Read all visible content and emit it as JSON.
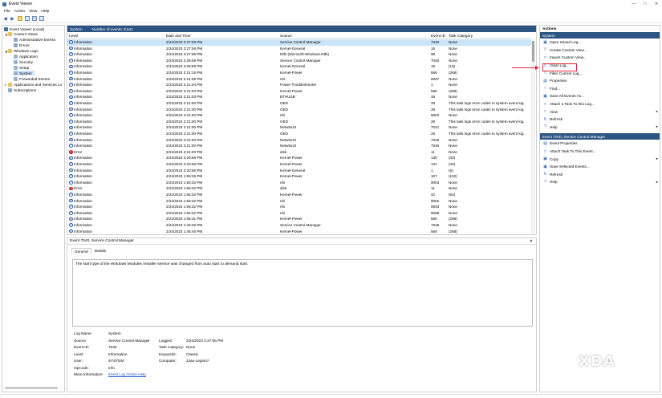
{
  "window": {
    "title": "Event Viewer"
  },
  "menu": [
    "File",
    "Action",
    "View",
    "Help"
  ],
  "tree": {
    "root": "Event Viewer (Local)",
    "custom_views": "Custom Views",
    "admin_events": "Administrative Events",
    "errors": "Errors",
    "windows_logs": "Windows Logs",
    "application": "Application",
    "security": "Security",
    "setup": "Setup",
    "system": "System",
    "forwarded": "Forwarded Events",
    "apps_services": "Applications and Services Lo",
    "subscriptions": "Subscriptions"
  },
  "events_panel": {
    "title": "System",
    "count": "Number of events: 8,641",
    "columns": {
      "level": "Level",
      "date": "Date and Time",
      "source": "Source",
      "id": "Event ID",
      "task": "Task Category"
    }
  },
  "events": [
    {
      "level": "Information",
      "date": "2/24/2023 2:27:06 PM",
      "source": "Service Control Manager",
      "id": "7040",
      "task": "None",
      "err": false
    },
    {
      "level": "Information",
      "date": "2/24/2023 2:27:06 PM",
      "source": "Kernel-General",
      "id": "16",
      "task": "None",
      "err": false
    },
    {
      "level": "Information",
      "date": "2/24/2023 2:27:06 PM",
      "source": "Ntfs (Microsoft-Windows-Ntfs)",
      "id": "98",
      "task": "None",
      "err": false
    },
    {
      "level": "Information",
      "date": "2/24/2023 2:26:59 PM",
      "source": "Service Control Manager",
      "id": "7040",
      "task": "None",
      "err": false
    },
    {
      "level": "Information",
      "date": "2/24/2023 2:26:58 PM",
      "source": "Kernel-General",
      "id": "15",
      "task": "(10)",
      "err": false
    },
    {
      "level": "Information",
      "date": "2/24/2023 2:21:15 PM",
      "source": "Kernel-Power",
      "id": "566",
      "task": "(268)",
      "err": false
    },
    {
      "level": "Information",
      "date": "2/24/2023 2:21:08 PM",
      "source": "nhi",
      "id": "9007",
      "task": "None",
      "err": false
    },
    {
      "level": "Information",
      "date": "2/24/2023 2:21:04 PM",
      "source": "Power-Troubleshooter",
      "id": "1",
      "task": "None",
      "err": false
    },
    {
      "level": "Information",
      "date": "2/24/2023 2:21:03 PM",
      "source": "Kernel-Power",
      "id": "566",
      "task": "(268)",
      "err": false
    },
    {
      "level": "Information",
      "date": "2/24/2023 2:21:03 PM",
      "source": "BTHUSB",
      "id": "18",
      "task": "None",
      "err": false
    },
    {
      "level": "Information",
      "date": "2/24/2023 2:21:00 PM",
      "source": "OED",
      "id": "28",
      "task": "This task logs error codes to system event log.",
      "err": false
    },
    {
      "level": "Information",
      "date": "2/24/2023 2:21:00 PM",
      "source": "OED",
      "id": "28",
      "task": "This task logs error codes to system event log.",
      "err": false
    },
    {
      "level": "Information",
      "date": "2/24/2023 2:21:00 PM",
      "source": "nhi",
      "id": "9002",
      "task": "None",
      "err": false
    },
    {
      "level": "Information",
      "date": "2/24/2023 2:21:00 PM",
      "source": "OED",
      "id": "28",
      "task": "This task logs error codes to system event log.",
      "err": false
    },
    {
      "level": "Information",
      "date": "2/24/2023 2:21:00 PM",
      "source": "Netwtw10",
      "id": "7021",
      "task": "None",
      "err": false
    },
    {
      "level": "Information",
      "date": "2/24/2023 2:21:00 PM",
      "source": "OED",
      "id": "28",
      "task": "This task logs error codes to system event log.",
      "err": false
    },
    {
      "level": "Information",
      "date": "2/24/2023 2:21:00 PM",
      "source": "Netwtw10",
      "id": "7025",
      "task": "None",
      "err": false
    },
    {
      "level": "Information",
      "date": "2/24/2023 2:21:00 PM",
      "source": "Netwtw10",
      "id": "7026",
      "task": "None",
      "err": false
    },
    {
      "level": "Error",
      "date": "2/24/2023 2:21:00 PM",
      "source": "disk",
      "id": "11",
      "task": "None",
      "err": true
    },
    {
      "level": "Information",
      "date": "2/24/2023 2:20:58 PM",
      "source": "Kernel-Power",
      "id": "130",
      "task": "(33)",
      "err": false
    },
    {
      "level": "Information",
      "date": "2/24/2023 2:20:58 PM",
      "source": "Kernel-Power",
      "id": "131",
      "task": "(33)",
      "err": false
    },
    {
      "level": "Information",
      "date": "2/24/2023 2:20:58 PM",
      "source": "Kernel-General",
      "id": "1",
      "task": "(5)",
      "err": false
    },
    {
      "level": "Information",
      "date": "2/24/2023 1:56:35 PM",
      "source": "Kernel-Power",
      "id": "107",
      "task": "(102)",
      "err": false
    },
    {
      "level": "Information",
      "date": "2/24/2023 1:56:32 PM",
      "source": "nhi",
      "id": "9003",
      "task": "None",
      "err": false
    },
    {
      "level": "Error",
      "date": "2/24/2023 1:56:32 PM",
      "source": "disk",
      "id": "11",
      "task": "None",
      "err": true
    },
    {
      "level": "Information",
      "date": "2/24/2023 1:56:32 PM",
      "source": "Kernel-Power",
      "id": "42",
      "task": "(64)",
      "err": false
    },
    {
      "level": "Information",
      "date": "2/24/2023 1:56:32 PM",
      "source": "nhi",
      "id": "9002",
      "task": "None",
      "err": false
    },
    {
      "level": "Information",
      "date": "2/24/2023 1:56:32 PM",
      "source": "nhi",
      "id": "9003",
      "task": "None",
      "err": false
    },
    {
      "level": "Information",
      "date": "2/24/2023 1:56:32 PM",
      "source": "nhi",
      "id": "9008",
      "task": "None",
      "err": false
    },
    {
      "level": "Information",
      "date": "2/24/2023 1:56:31 PM",
      "source": "Kernel-Power",
      "id": "566",
      "task": "(268)",
      "err": false
    },
    {
      "level": "Information",
      "date": "2/24/2023 1:46:46 PM",
      "source": "Service Control Manager",
      "id": "7045",
      "task": "None",
      "err": false
    },
    {
      "level": "Information",
      "date": "2/24/2023 1:46:46 PM",
      "source": "Kernel-Power",
      "id": "566",
      "task": "(268)",
      "err": false
    }
  ],
  "detail": {
    "title": "Event 7040, Service Control Manager",
    "tab_general": "General",
    "tab_details": "Details",
    "message": "The start type of the Windows Modules Installer service was changed from auto start to demand start.",
    "labels": {
      "log_name": "Log Name:",
      "source": "Source:",
      "event_id": "Event ID:",
      "level": "Level:",
      "user": "User:",
      "opcode": "OpCode:",
      "more_info": "More Information:",
      "logged": "Logged:",
      "task_category": "Task Category:",
      "keywords": "Keywords:",
      "computer": "Computer:"
    },
    "values": {
      "log_name": "System",
      "source": "Service Control Manager",
      "event_id": "7040",
      "level": "Information",
      "user": "SYSTEM",
      "opcode": "Info",
      "more_info": "Event Log Online Help",
      "logged": "2/24/2023 2:27:06 PM",
      "task_category": "None",
      "keywords": "Classic",
      "computer": "Joao-Legion7"
    }
  },
  "actions": {
    "title": "Actions",
    "section1": "System",
    "items1": [
      "Open Saved Log...",
      "Create Custom View...",
      "Import Custom View...",
      "Clear Log...",
      "Filter Current Log...",
      "Properties",
      "Find...",
      "Save All Events As...",
      "Attach a Task To this Log...",
      "View",
      "Refresh",
      "Help"
    ],
    "section2": "Event 7040, Service Control Manager",
    "items2": [
      "Event Properties",
      "Attach Task To This Event...",
      "Copy",
      "Save Selected Events...",
      "Refresh",
      "Help"
    ]
  },
  "watermark": "XDA",
  "colors": {
    "accent": "#2d5584",
    "highlight": "#e0253a",
    "selection": "#cce4f7"
  }
}
